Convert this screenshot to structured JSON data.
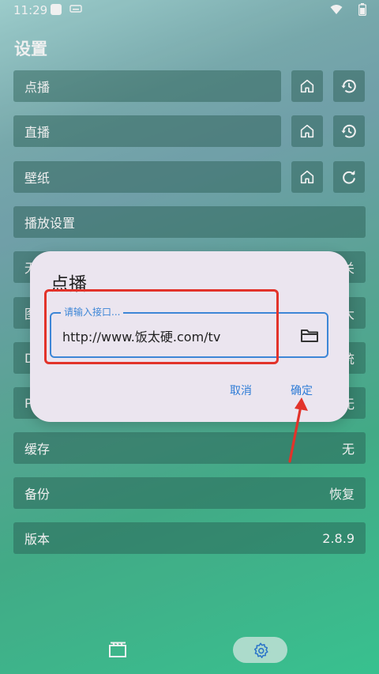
{
  "status_bar": {
    "time": "11:29"
  },
  "page_title": "设置",
  "rows": [
    {
      "label": "点播",
      "value": ""
    },
    {
      "label": "直播",
      "value": ""
    },
    {
      "label": "壁纸",
      "value": ""
    },
    {
      "label": "播放设置",
      "value": ""
    },
    {
      "label": "无",
      "value": "关"
    },
    {
      "label": "图",
      "value": "大"
    },
    {
      "label": "D",
      "value": "统"
    },
    {
      "label": "P",
      "value": "无"
    },
    {
      "label": "缓存",
      "value": "无"
    },
    {
      "label": "备份",
      "value": "恢复"
    },
    {
      "label": "版本",
      "value": "2.8.9"
    }
  ],
  "dialog": {
    "title": "点播",
    "field_label": "请输入接口...",
    "field_value": "http://www.饭太硬.com/tv",
    "cancel": "取消",
    "confirm": "确定"
  },
  "icons": {
    "home": "home-icon",
    "history": "history-icon",
    "refresh": "refresh-icon",
    "folder": "folder-icon",
    "film": "film-icon",
    "settings": "settings-icon"
  },
  "colors": {
    "accent": "#3d86d6",
    "annotation": "#e2332a",
    "dialog_bg": "#ebe5ef"
  }
}
